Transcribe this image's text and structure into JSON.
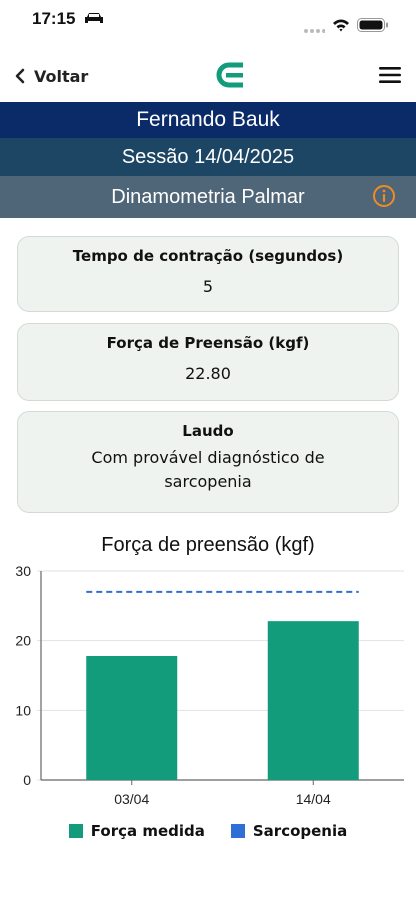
{
  "status_bar": {
    "time": "17:15"
  },
  "nav": {
    "back_label": "Voltar"
  },
  "header": {
    "patient_name": "Fernando Bauk",
    "session": "Sessão 14/04/2025",
    "test_name": "Dinamometria Palmar"
  },
  "cards": [
    {
      "title": "Tempo de contração (segundos)",
      "value": "5"
    },
    {
      "title": "Força de Preensão (kgf)",
      "value": "22.80"
    },
    {
      "title": "Laudo",
      "value": "Com provável diagnóstico de sarcopenia"
    }
  ],
  "colors": {
    "accent": "#129c7c",
    "threshold": "#2f6fd6"
  },
  "chart_data": {
    "type": "bar",
    "title": "Força de preensão (kgf)",
    "categories": [
      "03/04",
      "14/04"
    ],
    "series": [
      {
        "name": "Força medida",
        "values": [
          17.8,
          22.8
        ]
      },
      {
        "name": "Sarcopenia",
        "values": [
          27,
          27
        ],
        "style": "dashed line"
      }
    ],
    "ylim": [
      0,
      30
    ],
    "yticks": [
      "0",
      "10",
      "20",
      "30"
    ],
    "grid": true,
    "legend": "bottom"
  }
}
